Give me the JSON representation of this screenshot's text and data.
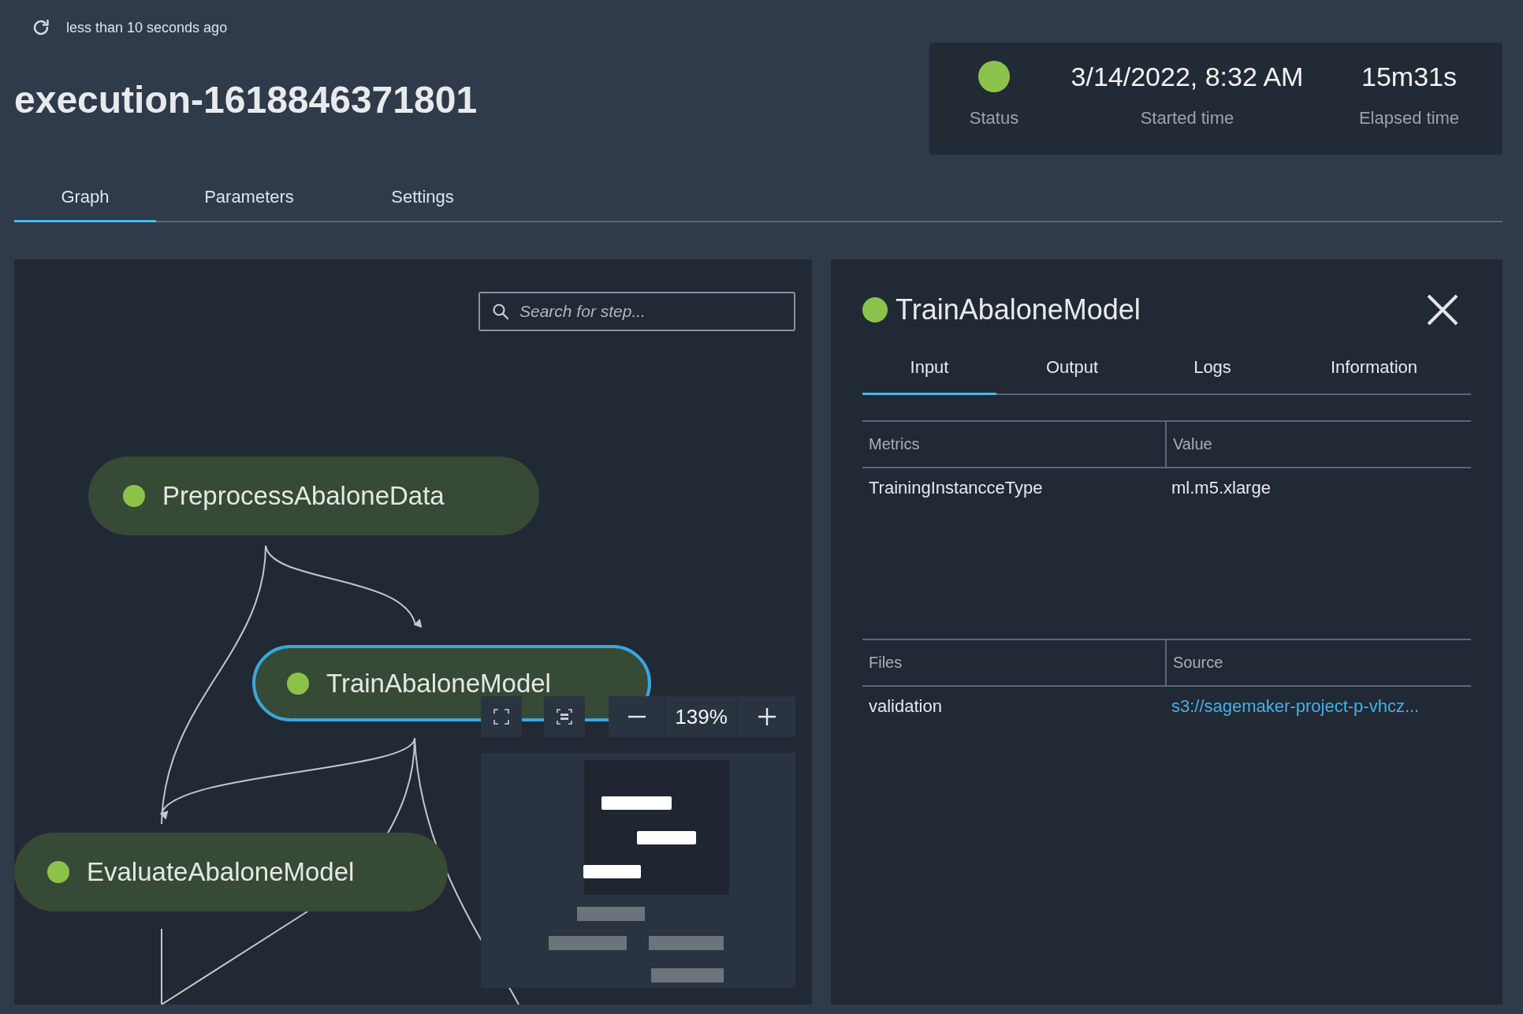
{
  "header": {
    "refresh_text": "less than 10 seconds ago",
    "title": "execution-1618846371801"
  },
  "summary": {
    "status": {
      "label": "Status",
      "color": "#8bc34a"
    },
    "started": {
      "value": "3/14/2022, 8:32 AM",
      "label": "Started time"
    },
    "elapsed": {
      "value": "15m31s",
      "label": "Elapsed time"
    }
  },
  "tabs": [
    {
      "label": "Graph",
      "selected": true
    },
    {
      "label": "Parameters",
      "selected": false
    },
    {
      "label": "Settings",
      "selected": false
    }
  ],
  "graph": {
    "search": {
      "placeholder": "Search for step..."
    },
    "nodes": [
      {
        "name": "PreprocessAbaloneData",
        "color": "#8bc34a",
        "selected": false
      },
      {
        "name": "TrainAbaloneModel",
        "color": "#8bc34a",
        "selected": true
      },
      {
        "name": "EvaluateAbaloneModel",
        "color": "#8bc34a",
        "selected": false
      }
    ],
    "zoom": {
      "reading": "139%"
    }
  },
  "detail": {
    "title": "TrainAbaloneModel",
    "color": "#8bc34a",
    "tabs": [
      {
        "label": "Input",
        "selected": true
      },
      {
        "label": "Output",
        "selected": false
      },
      {
        "label": "Logs",
        "selected": false
      },
      {
        "label": "Information",
        "selected": false
      }
    ],
    "tables": [
      {
        "columns": [
          "Metrics",
          "Value"
        ],
        "rows": [
          [
            {
              "text": "TrainingInstancceType",
              "kind": "text"
            },
            {
              "text": "ml.m5.xlarge",
              "kind": "text"
            }
          ]
        ]
      },
      {
        "columns": [
          "Files",
          "Source"
        ],
        "rows": [
          [
            {
              "text": "validation",
              "kind": "text"
            },
            {
              "text": "s3://sagemaker-project-p-vhcz...",
              "kind": "link"
            }
          ]
        ]
      }
    ]
  }
}
